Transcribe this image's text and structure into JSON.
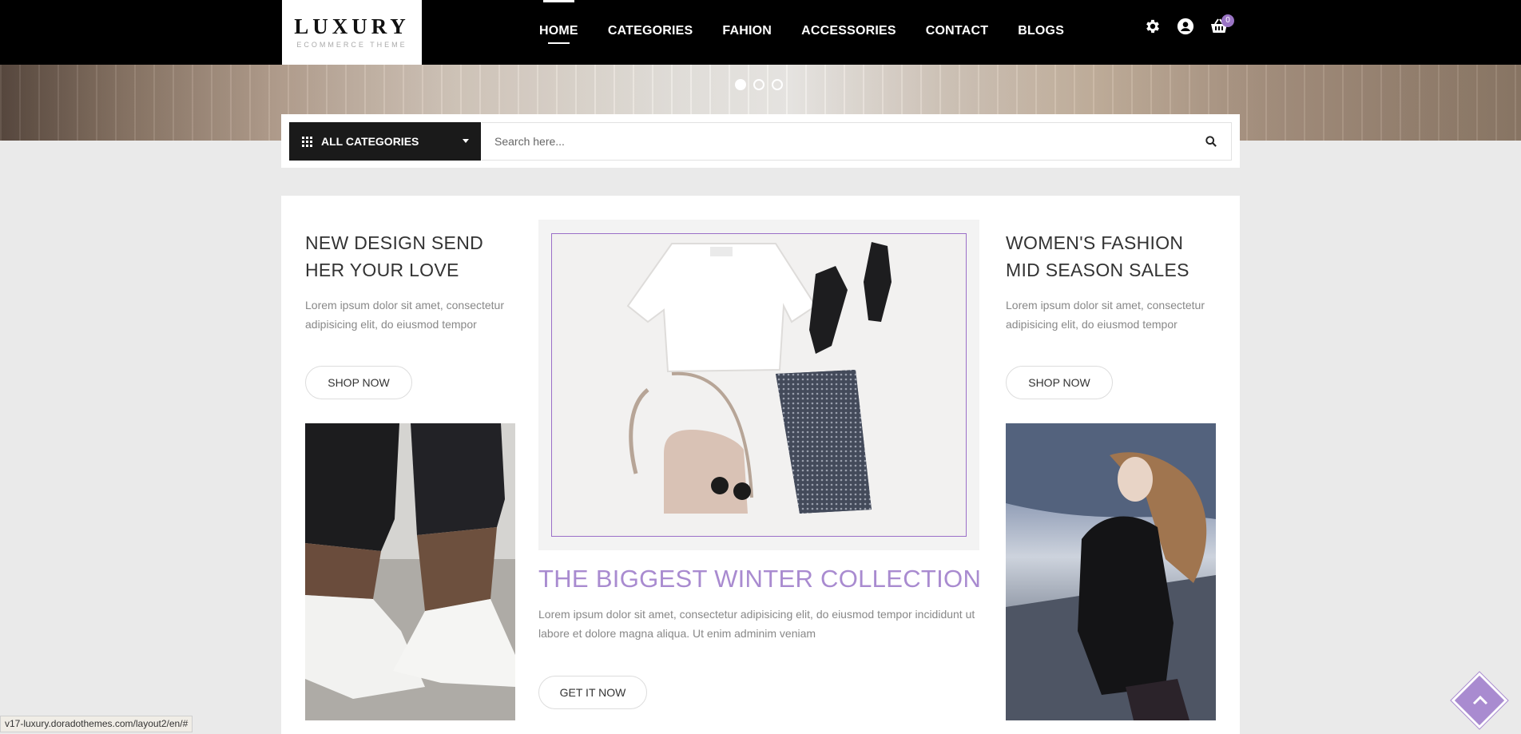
{
  "header": {
    "logo_main": "LUXURY",
    "logo_sub": "ECOMMERCE THEME",
    "nav": [
      "HOME",
      "CATEGORIES",
      "FAHION",
      "ACCESSORIES",
      "CONTACT",
      "BLOGS"
    ],
    "active_nav": "HOME",
    "icons": [
      "gear-icon",
      "user-icon",
      "cart-icon"
    ],
    "cart_count": "0"
  },
  "slider": {
    "dots": 3,
    "active_dot": 1
  },
  "search": {
    "category_label": "ALL CATEGORIES",
    "placeholder": "Search here..."
  },
  "promo_left": {
    "title": "NEW DESIGN SEND HER YOUR LOVE",
    "text": "Lorem ipsum dolor sit amet, consectetur adipisicing elit, do eiusmod tempor",
    "button": "SHOP NOW"
  },
  "promo_center": {
    "title": "THE BIGGEST WINTER COLLECTION",
    "text": "Lorem ipsum dolor sit amet, consectetur adipisicing elit, do eiusmod tempor incididunt ut labore et dolore magna aliqua. Ut enim adminim veniam",
    "button": "GET IT NOW"
  },
  "promo_right": {
    "title": "WOMEN'S FASHION MID SEASON SALES",
    "text": "Lorem ipsum dolor sit amet, consectetur adipisicing elit, do eiusmod tempor",
    "button": "SHOP NOW"
  },
  "status_url": "v17-luxury.doradothemes.com/layout2/en/#",
  "colors": {
    "accent": "#a98bd0",
    "topbar": "#000000",
    "background": "#eaeaea"
  }
}
